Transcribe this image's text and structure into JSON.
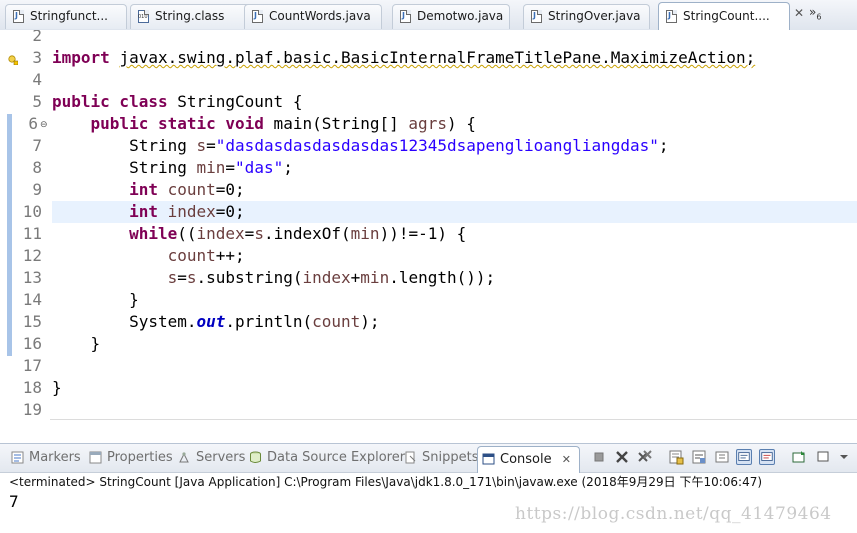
{
  "editor_tabs": [
    {
      "label": "Stringfunct...",
      "type": "java"
    },
    {
      "label": "String.class",
      "type": "class"
    },
    {
      "label": "CountWords.java",
      "type": "java"
    },
    {
      "label": "Demotwo.java",
      "type": "java"
    },
    {
      "label": "StringOver.java",
      "type": "java"
    },
    {
      "label": "StringCount....",
      "type": "java",
      "active": true
    }
  ],
  "tab_close": "✕",
  "tab_overflow": {
    "glyph": "»",
    "count": "6"
  },
  "line_numbers": [
    "2",
    "3",
    "4",
    "5",
    "6",
    "7",
    "8",
    "9",
    "10",
    "11",
    "12",
    "13",
    "14",
    "15",
    "16",
    "17",
    "18",
    "19"
  ],
  "code": {
    "l3_kw": "import",
    "l3_rest": "javax.swing.plaf.basic.BasicInternalFrameTitlePane.MaximizeAction;",
    "l5_kw": "public class",
    "l5_rest": " StringCount {",
    "l6_kw": "public static void",
    "l6_a": " main(String[] ",
    "l6_var": "agrs",
    "l6_b": ") {",
    "l7_a": "String ",
    "l7_var": "s",
    "l7_b": "=",
    "l7_str": "\"dasdasdasdasdasdas12345dsapenglioangliangdas\"",
    "l7_c": ";",
    "l8_a": "String ",
    "l8_var": "min",
    "l8_b": "=",
    "l8_str": "\"das\"",
    "l8_c": ";",
    "l9_kw": "int",
    "l9_var": "count",
    "l9_b": "=0;",
    "l10_kw": "int",
    "l10_var": "index",
    "l10_b": "=0;",
    "l11_kw": "while",
    "l11_a": "((",
    "l11_v1": "index",
    "l11_b": "=",
    "l11_v2": "s",
    "l11_c": ".indexOf(",
    "l11_v3": "min",
    "l11_d": "))!=-1) {",
    "l12_var": "count",
    "l12_b": "++;",
    "l13_v1": "s",
    "l13_a": "=",
    "l13_v2": "s",
    "l13_b": ".substring(",
    "l13_v3": "index",
    "l13_c": "+",
    "l13_v4": "min",
    "l13_d": ".length());",
    "l14": "}",
    "l15_a": "System.",
    "l15_field": "out",
    "l15_b": ".println(",
    "l15_var": "count",
    "l15_c": ");",
    "l16": "}",
    "l18": "}"
  },
  "panel_tabs": [
    {
      "label": "Markers",
      "icon": "markers-icon"
    },
    {
      "label": "Properties",
      "icon": "properties-icon"
    },
    {
      "label": "Servers",
      "icon": "servers-icon"
    },
    {
      "label": "Data Source Explorer",
      "icon": "data-source-icon"
    },
    {
      "label": "Snippets",
      "icon": "snippets-icon"
    },
    {
      "label": "Console",
      "icon": "console-icon",
      "active": true
    }
  ],
  "console_close": "✕",
  "console": {
    "status": "<terminated> StringCount [Java Application] C:\\Program Files\\Java\\jdk1.8.0_171\\bin\\javaw.exe (2018年9月29日 下午10:06:47)",
    "output": "7"
  },
  "watermark": "https://blog.csdn.net/qq_41479464",
  "colors": {
    "keyword": "#7f0055",
    "string": "#2a00ff",
    "variable": "#6a3e3e",
    "static_field": "#0000c0",
    "current_line": "#e8f2fe"
  }
}
